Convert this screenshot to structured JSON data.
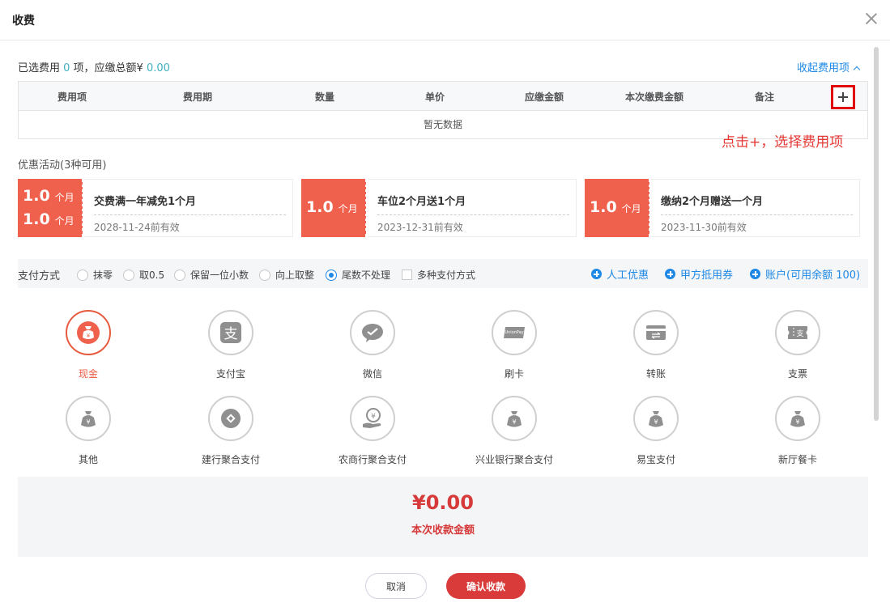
{
  "dialog": {
    "title": "收费"
  },
  "summary": {
    "prefix": "已选费用 ",
    "count": "0",
    "mid": " 项，应缴总额¥ ",
    "total": "0.00"
  },
  "collapse_label": "收起费用项",
  "fee_table": {
    "columns": [
      "费用项",
      "费用期",
      "数量",
      "单价",
      "应缴金额",
      "本次缴费金额",
      "备注"
    ],
    "empty_text": "暂无数据",
    "add_symbol": "+"
  },
  "annotation": "点击+，选择费用项",
  "promotions": {
    "title": "优惠活动(3种可用)",
    "items": [
      {
        "amounts": [
          {
            "value": "1.0",
            "unit": "个月"
          },
          {
            "value": "1.0",
            "unit": "个月"
          }
        ],
        "name": "交费满一年减免1个月",
        "valid": "2028-11-24前有效"
      },
      {
        "amounts": [
          {
            "value": "1.0",
            "unit": "个月"
          }
        ],
        "name": "车位2个月送1个月",
        "valid": "2023-12-31前有效"
      },
      {
        "amounts": [
          {
            "value": "1.0",
            "unit": "个月"
          }
        ],
        "name": "缴纳2个月赠送一个月",
        "valid": "2023-11-30前有效"
      }
    ]
  },
  "payment_bar": {
    "label": "支付方式",
    "rounding_options": [
      "抹零",
      "取0.5",
      "保留一位小数",
      "向上取整",
      "尾数不处理"
    ],
    "selected_rounding": "尾数不处理",
    "multi_pay_label": "多种支付方式",
    "links": [
      "人工优惠",
      "甲方抵用券",
      "账户(可用余额 100)"
    ]
  },
  "payment_methods": [
    {
      "label": "现金",
      "icon": "money-bag-icon",
      "active": true
    },
    {
      "label": "支付宝",
      "icon": "alipay-icon"
    },
    {
      "label": "微信",
      "icon": "wechat-icon"
    },
    {
      "label": "刷卡",
      "icon": "bank-card-icon"
    },
    {
      "label": "转账",
      "icon": "transfer-icon"
    },
    {
      "label": "支票",
      "icon": "cheque-icon"
    },
    {
      "label": "其他",
      "icon": "money-bag-icon"
    },
    {
      "label": "建行聚合支付",
      "icon": "ccb-icon"
    },
    {
      "label": "农商行聚合支付",
      "icon": "coin-hand-icon"
    },
    {
      "label": "兴业银行聚合支付",
      "icon": "money-bag-icon"
    },
    {
      "label": "易宝支付",
      "icon": "money-bag-icon"
    },
    {
      "label": "新厅餐卡",
      "icon": "money-bag-icon"
    }
  ],
  "icon_text": {
    "currency": "¥",
    "zhi": "支",
    "unionpay": "UnionPay"
  },
  "total": {
    "amount": "¥0.00",
    "label": "本次收款金额"
  },
  "buttons": {
    "cancel": "取消",
    "confirm": "确认收款"
  },
  "colors": {
    "accent_red": "#d93a3a",
    "coupon_red": "#f0614d",
    "link_blue": "#1e88e5",
    "teal": "#3fb0c1",
    "annotation_red": "#e53935"
  }
}
